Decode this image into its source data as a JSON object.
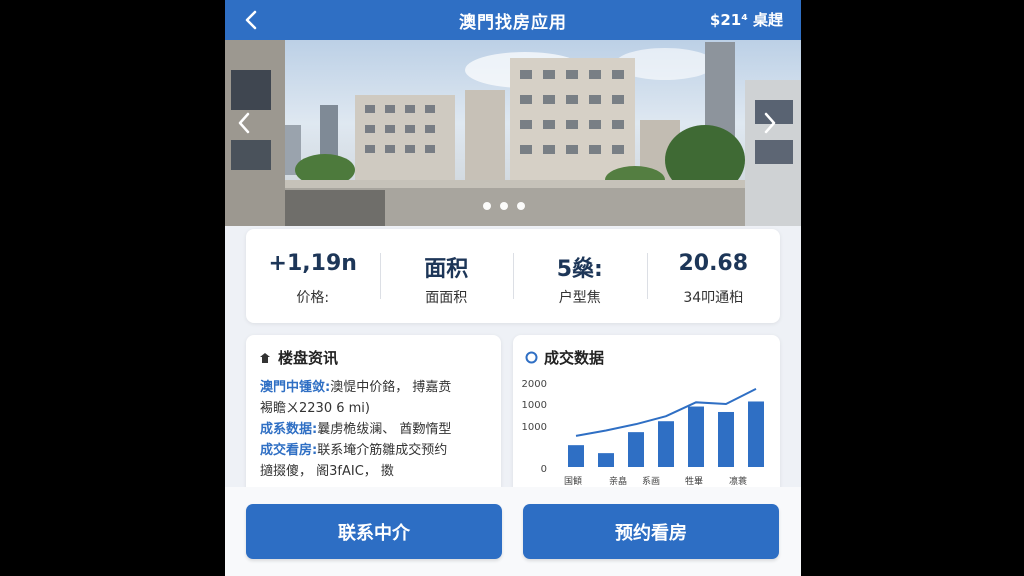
{
  "header": {
    "title": "澳門找房应用",
    "right_text": "$21⁴ 桌趕",
    "back_icon": "chevron-left-icon"
  },
  "hero": {
    "slide_count": 3,
    "prev_icon": "chevron-left-icon",
    "next_icon": "chevron-right-icon"
  },
  "stats": [
    {
      "value": "+1,19n",
      "label": "价格:"
    },
    {
      "value": "面积",
      "label": "面面积"
    },
    {
      "value": "5燊:",
      "label": "户型焦"
    },
    {
      "value": "20.68",
      "label": "34叩通桕"
    }
  ],
  "info_card": {
    "title": "楼盘资讯",
    "icon": "building-icon",
    "lines": [
      {
        "key": "澳門中锺敛:",
        "text": "澳惿中价鉻，  搏嘉贲"
      },
      {
        "key": "",
        "text": "裼瞻ㄨ2230 6  mi)"
      },
      {
        "key": "成系数据:",
        "text": "曩虏桅绂澜、  酋覅惰型"
      },
      {
        "key": "成交看房:",
        "text": "联系埯介筋雛成交预约"
      },
      {
        "key": "",
        "text": "擿掇傻，  阁3fAIC，  擞"
      }
    ]
  },
  "deal_card": {
    "title": "成交数据",
    "icon": "circle-icon"
  },
  "chart_data": {
    "type": "bar",
    "y_ticks": [
      "2000",
      "1000",
      "1000",
      "0"
    ],
    "categories": [
      "国顀",
      "亲皛",
      "系画",
      "牲畢",
      "凛蓑"
    ],
    "values": [
      520,
      330,
      830,
      1090,
      1440,
      1310,
      1560
    ],
    "line_values": [
      740,
      870,
      1020,
      1210,
      1540,
      1500,
      1860
    ],
    "ylim": [
      0,
      2000
    ],
    "colors": {
      "bar": "#2f6fc4",
      "line": "#2f6fc4"
    }
  },
  "actions": {
    "contact_label": "联系中介",
    "visit_label": "预约看房"
  },
  "colors": {
    "primary": "#2f6fc4",
    "background": "#eef1f6"
  }
}
